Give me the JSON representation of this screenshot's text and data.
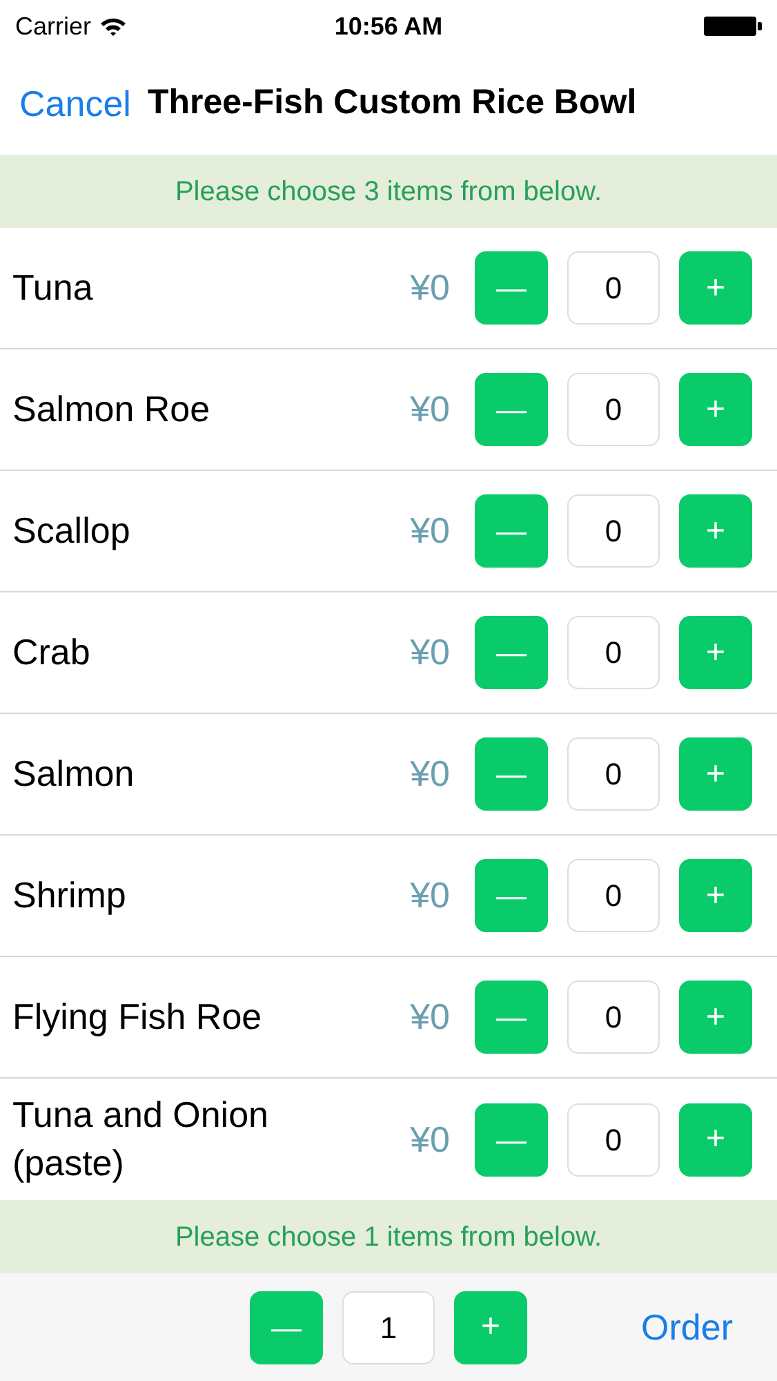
{
  "status_bar": {
    "carrier": "Carrier",
    "time": "10:56 AM"
  },
  "nav": {
    "cancel": "Cancel",
    "title": "Three-Fish Custom Rice Bowl"
  },
  "banner_top": "Please choose 3 items from below.",
  "items": [
    {
      "name": "Tuna",
      "price": "¥0",
      "minus": "—",
      "quantity": "0",
      "plus": "+"
    },
    {
      "name": "Salmon Roe",
      "price": "¥0",
      "minus": "—",
      "quantity": "0",
      "plus": "+"
    },
    {
      "name": "Scallop",
      "price": "¥0",
      "minus": "—",
      "quantity": "0",
      "plus": "+"
    },
    {
      "name": "Crab",
      "price": "¥0",
      "minus": "—",
      "quantity": "0",
      "plus": "+"
    },
    {
      "name": "Salmon",
      "price": "¥0",
      "minus": "—",
      "quantity": "0",
      "plus": "+"
    },
    {
      "name": "Shrimp",
      "price": "¥0",
      "minus": "—",
      "quantity": "0",
      "plus": "+"
    },
    {
      "name": "Flying Fish Roe",
      "price": "¥0",
      "minus": "—",
      "quantity": "0",
      "plus": "+"
    },
    {
      "name": "Tuna and Onion (paste)",
      "price": "¥0",
      "minus": "—",
      "quantity": "0",
      "plus": "+"
    }
  ],
  "banner_bottom": "Please choose 1 items from below.",
  "bottom_bar": {
    "minus": "—",
    "quantity": "1",
    "plus": "+",
    "order": "Order"
  }
}
